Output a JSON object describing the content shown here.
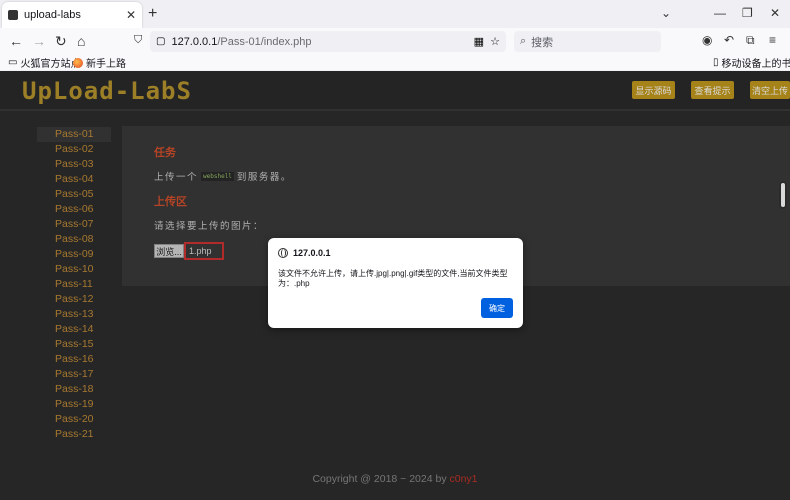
{
  "browser": {
    "tab_title": "upload-labs",
    "url_host": "127.0.0.1",
    "url_path": "/Pass-01/index.php",
    "search_placeholder": "搜索",
    "bookmarks": [
      {
        "label": "火狐官方站点"
      },
      {
        "label": "新手上路"
      }
    ],
    "mobile_bookmarks": "移动设备上的书签"
  },
  "header": {
    "logo": "UpLoad-LabS",
    "buttons": [
      "显示源码",
      "查看提示",
      "清空上传"
    ]
  },
  "sidebar": {
    "items": [
      "Pass-01",
      "Pass-02",
      "Pass-03",
      "Pass-04",
      "Pass-05",
      "Pass-06",
      "Pass-07",
      "Pass-08",
      "Pass-09",
      "Pass-10",
      "Pass-11",
      "Pass-12",
      "Pass-13",
      "Pass-14",
      "Pass-15",
      "Pass-16",
      "Pass-17",
      "Pass-18",
      "Pass-19",
      "Pass-20",
      "Pass-21"
    ],
    "active_index": 0
  },
  "main": {
    "task_heading": "任务",
    "task_prefix": "上传一个",
    "task_code": "webshell",
    "task_suffix": "到服务器。",
    "upload_heading": "上传区",
    "choose_label": "请选择要上传的图片：",
    "browse_label": "浏览...",
    "file_name": "1.php"
  },
  "footer": {
    "copyright": "Copyright @ 2018 ~ 2024 by ",
    "author": "c0ny1"
  },
  "dialog": {
    "origin": "127.0.0.1",
    "message": "该文件不允许上传，请上传.jpg|.png|.gif类型的文件,当前文件类型为：.php",
    "ok_label": "确定"
  },
  "colors": {
    "accent_gold": "#c39a1d",
    "sidebar_text": "#c58e39",
    "heading_red": "#d4502c",
    "dialog_button": "#0061e0"
  }
}
